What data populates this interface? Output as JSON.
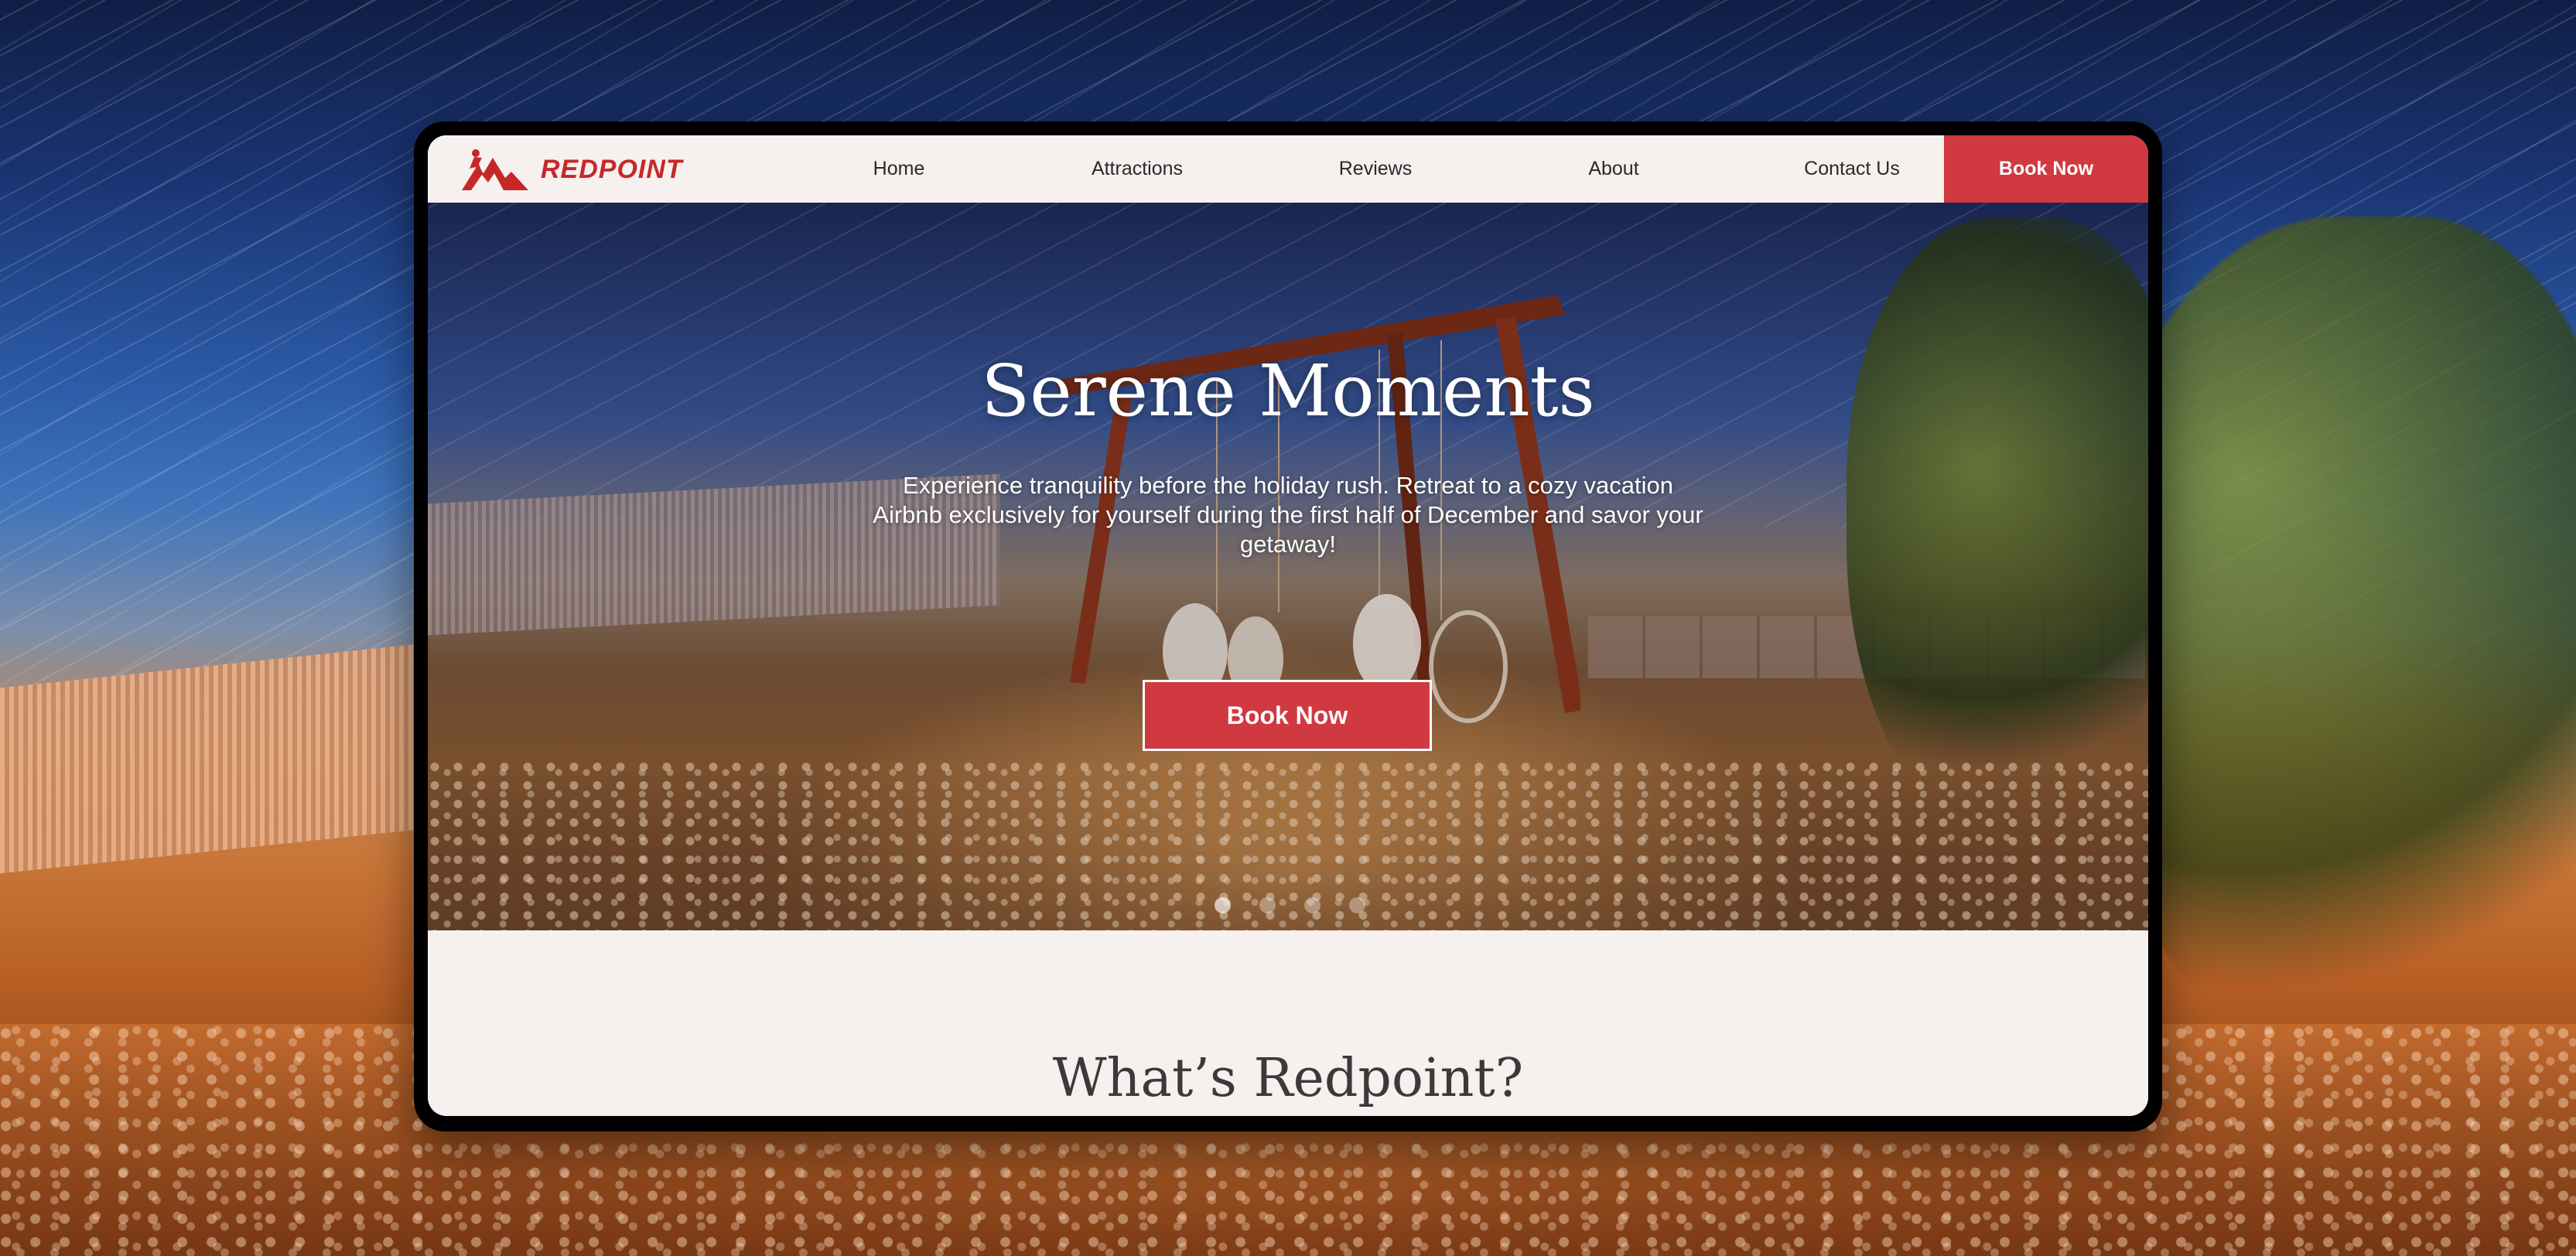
{
  "nav": {
    "brand": "REDPOINT",
    "links": [
      "Home",
      "Attractions",
      "Reviews",
      "About",
      "Contact Us"
    ],
    "cta": "Book Now"
  },
  "hero": {
    "title": "Serene Moments",
    "subtitle": "Experience tranquility before the holiday rush. Retreat to a cozy vacation Airbnb exclusively for yourself during the first half of December and savor your getaway!",
    "cta": "Book Now",
    "slides_total": 4,
    "slide_active": 1
  },
  "section": {
    "title": "What’s Redpoint?"
  },
  "colors": {
    "accent": "#d0393f",
    "brand": "#c62828",
    "page_bg": "#f6f0ef",
    "text": "#2a2a2a"
  },
  "icons": {
    "logo": "climber-mountain-logo-icon"
  }
}
